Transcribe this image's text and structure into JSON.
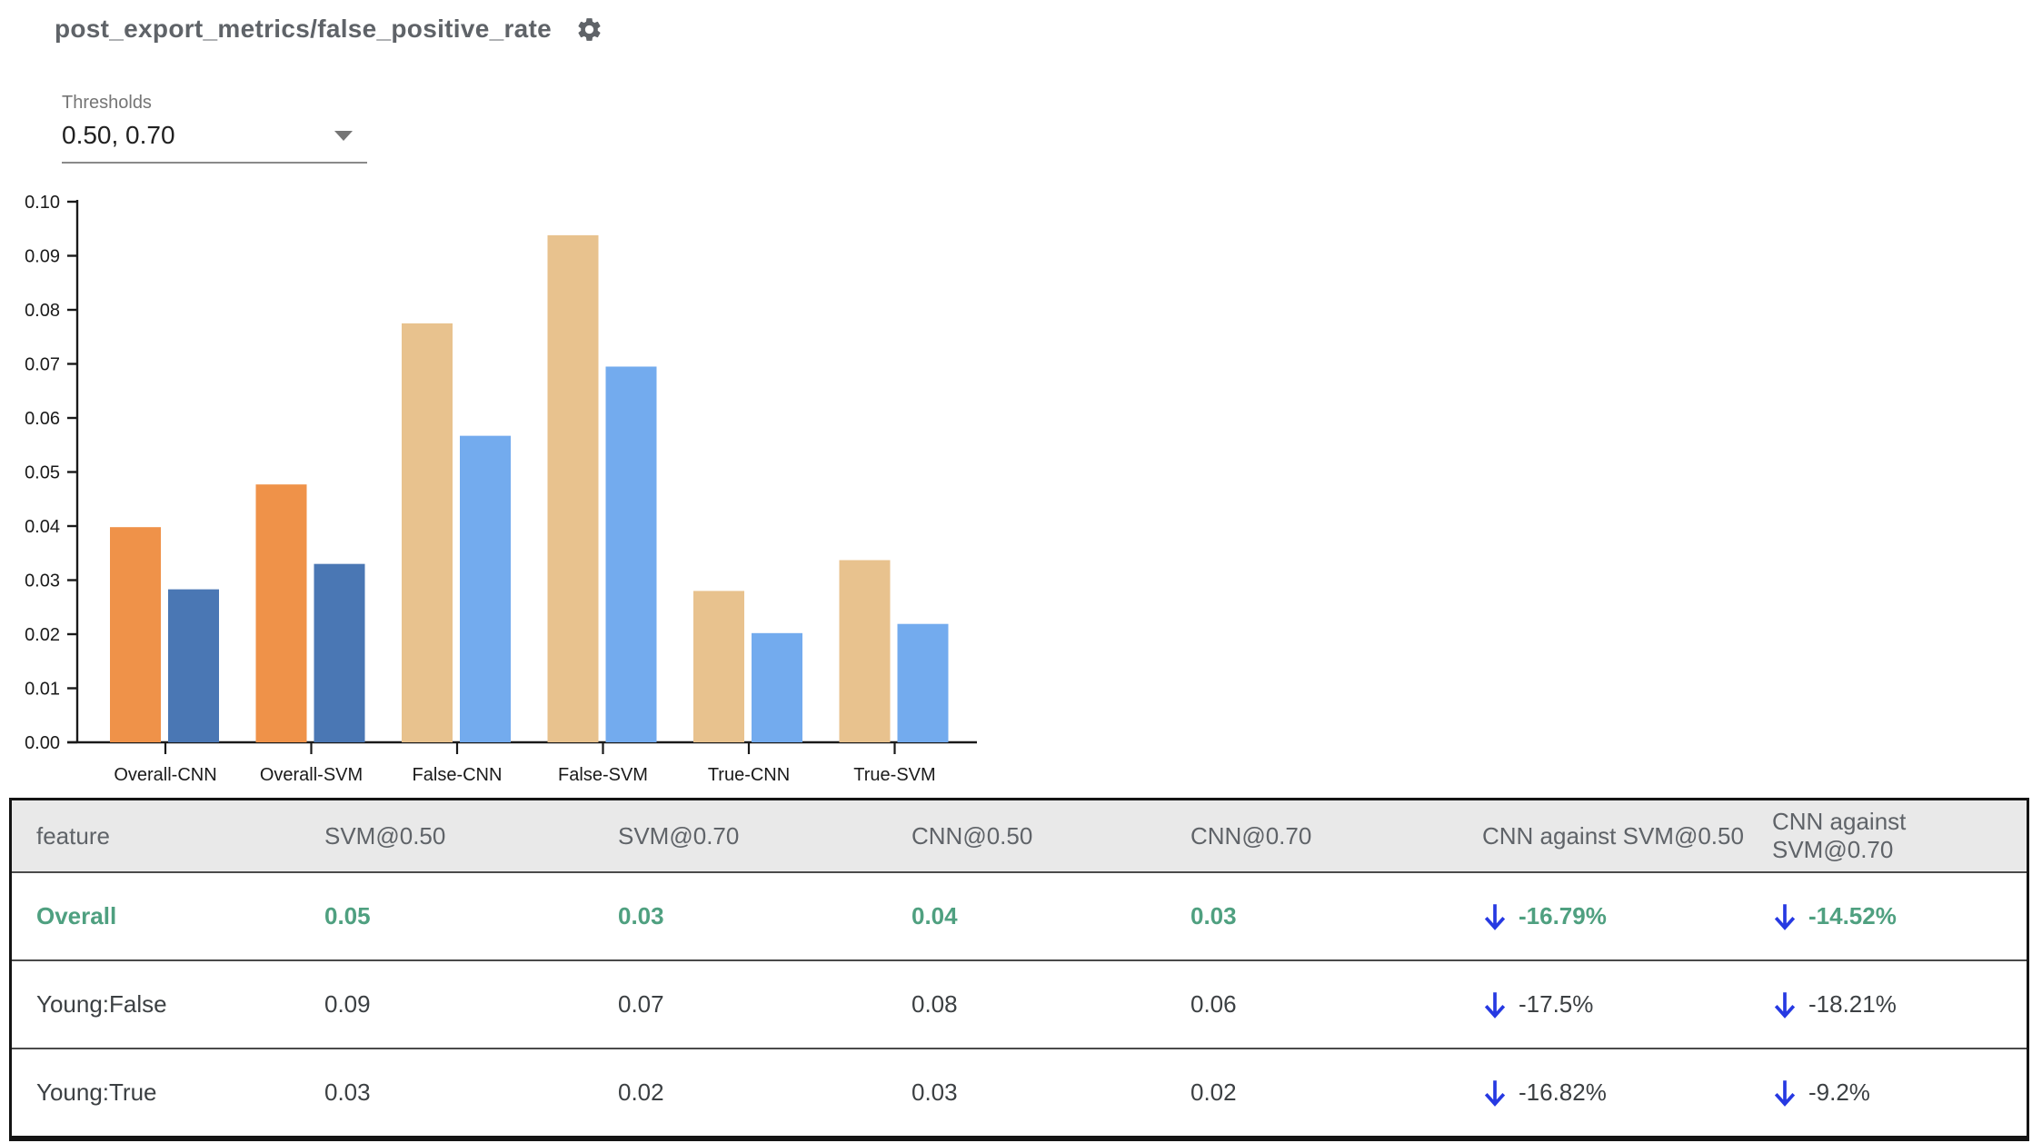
{
  "header": {
    "title": "post_export_metrics/false_positive_rate"
  },
  "controls": {
    "thresholds_label": "Thresholds",
    "thresholds_value": "0.50, 0.70"
  },
  "colors": {
    "overall_threshold_050": "#EF9249",
    "overall_threshold_070": "#4A77B4",
    "slice_threshold_050": "#E8C28E",
    "slice_threshold_070": "#73ABEE",
    "highlight_green": "#4FA080",
    "arrow_blue": "#2639E2",
    "header_bg": "#E9E9E9"
  },
  "chart_data": {
    "type": "bar",
    "title": "",
    "xlabel": "",
    "ylabel": "",
    "categories": [
      "Overall-CNN",
      "Overall-SVM",
      "False-CNN",
      "False-SVM",
      "True-CNN",
      "True-SVM"
    ],
    "series": [
      {
        "name": "threshold 0.50",
        "values": [
          0.0398,
          0.0477,
          0.0775,
          0.0938,
          0.028,
          0.0337
        ],
        "colors": [
          "#EF9249",
          "#EF9249",
          "#E8C28E",
          "#E8C28E",
          "#E8C28E",
          "#E8C28E"
        ]
      },
      {
        "name": "threshold 0.70",
        "values": [
          0.0283,
          0.033,
          0.0567,
          0.0695,
          0.0202,
          0.0219
        ],
        "colors": [
          "#4A77B4",
          "#4A77B4",
          "#73ABEE",
          "#73ABEE",
          "#73ABEE",
          "#73ABEE"
        ]
      }
    ],
    "ylim": [
      0,
      0.1
    ],
    "yticks": [
      "0.00",
      "0.01",
      "0.02",
      "0.03",
      "0.04",
      "0.05",
      "0.06",
      "0.07",
      "0.08",
      "0.09",
      "0.10"
    ],
    "grid": false,
    "legend": false
  },
  "table": {
    "columns": [
      "feature",
      "SVM@0.50",
      "SVM@0.70",
      "CNN@0.50",
      "CNN@0.70",
      "CNN against SVM@0.50",
      "CNN against SVM@0.70"
    ],
    "rows": [
      {
        "feature": "Overall",
        "values": [
          "0.05",
          "0.03",
          "0.04",
          "0.03"
        ],
        "deltas": [
          "-16.79%",
          "-14.52%"
        ],
        "highlight": true
      },
      {
        "feature": "Young:False",
        "values": [
          "0.09",
          "0.07",
          "0.08",
          "0.06"
        ],
        "deltas": [
          "-17.5%",
          "-18.21%"
        ],
        "highlight": false
      },
      {
        "feature": "Young:True",
        "values": [
          "0.03",
          "0.02",
          "0.03",
          "0.02"
        ],
        "deltas": [
          "-16.82%",
          "-9.2%"
        ],
        "highlight": false
      }
    ]
  }
}
